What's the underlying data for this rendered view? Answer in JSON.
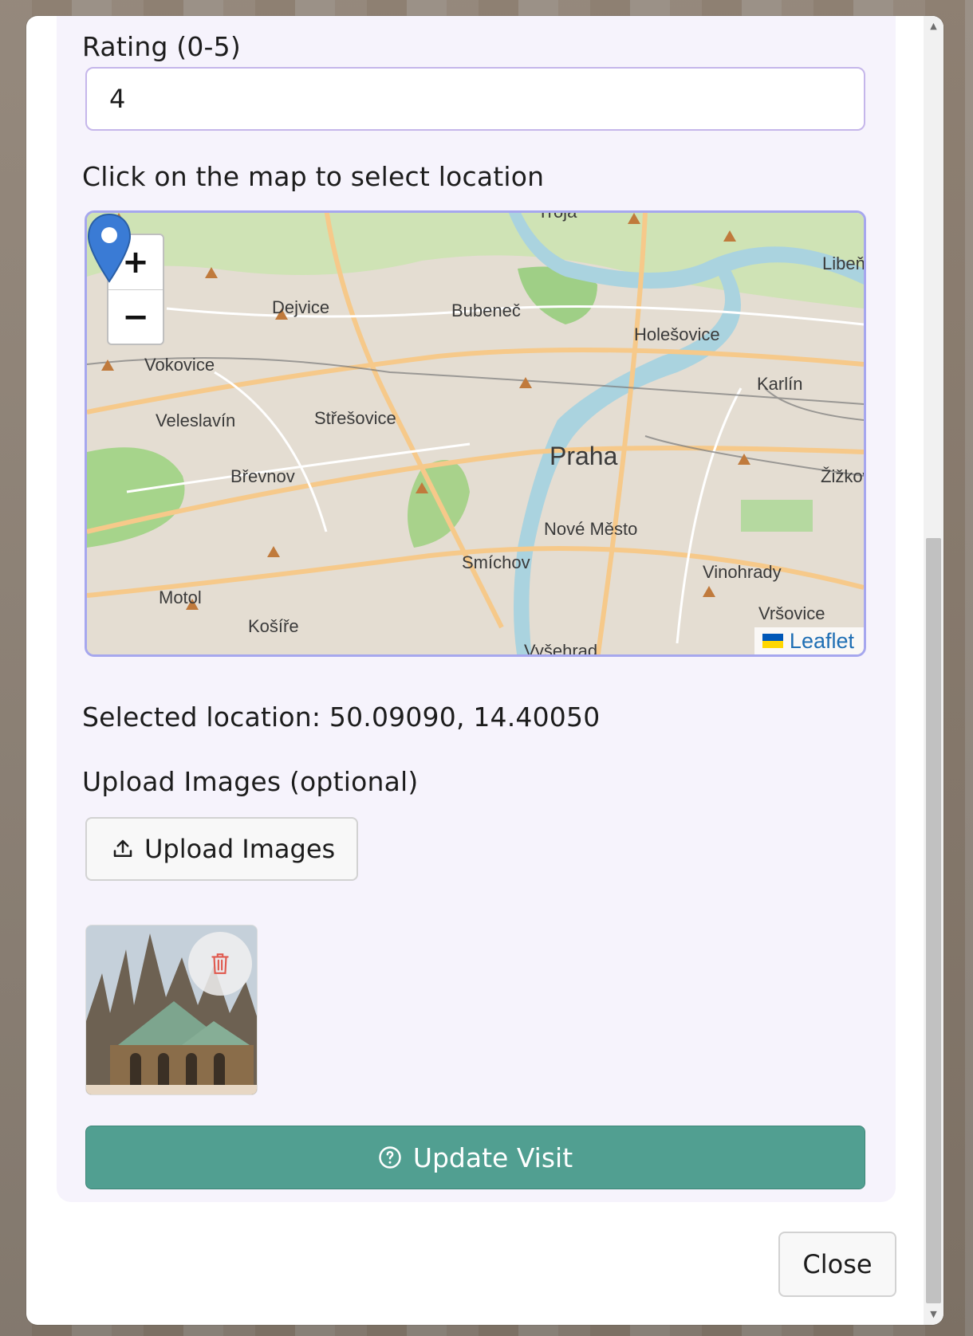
{
  "form": {
    "rating_label": "Rating (0-5)",
    "rating_value": "4",
    "map_label": "Click on the map to select location",
    "selected_location": "Selected location: 50.09090, 14.40050",
    "upload_label": "Upload Images (optional)",
    "upload_button": "Upload Images",
    "submit_button": "Update Visit"
  },
  "map": {
    "zoom_in": "+",
    "zoom_out": "−",
    "attribution": "Leaflet",
    "places": [
      "Troja",
      "Dejvice",
      "Bubeneč",
      "Holešovice",
      "Libeň",
      "Vokovice",
      "Karlín",
      "Veleslavín",
      "Střešovice",
      "Praha",
      "Břevnov",
      "Žižkov",
      "Nové Město",
      "Smíchov",
      "Vinohrady",
      "Motol",
      "Košíře",
      "Vršovice",
      "Vyšehrad"
    ],
    "marker": {
      "lat": 50.0909,
      "lng": 14.4005
    }
  },
  "images": [
    {
      "alt": "cathedral-photo"
    }
  ],
  "footer": {
    "close_button": "Close"
  },
  "colors": {
    "accent": "#519f91",
    "card_bg": "#f6f3fc",
    "input_border": "#c5b6ea",
    "map_border": "#a6a7ee",
    "marker": "#3a7bd5"
  },
  "icons": {
    "upload": "upload-icon",
    "help": "help-circle-icon",
    "delete": "trash-icon",
    "marker": "map-pin-icon"
  }
}
